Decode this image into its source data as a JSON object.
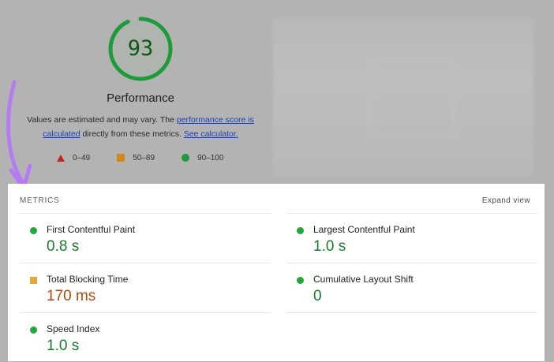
{
  "score": {
    "value": "93",
    "fraction": 0.93,
    "title": "Performance"
  },
  "description": {
    "text_before": "Values are estimated and may vary. The ",
    "link_score": "performance score is calculated",
    "text_middle": " directly from these metrics. ",
    "link_calculator": "See calculator."
  },
  "legend": [
    {
      "range": "0–49",
      "shape": "triangle",
      "color": "#c0231b"
    },
    {
      "range": "50–89",
      "shape": "square",
      "color": "#d4861f"
    },
    {
      "range": "90–100",
      "shape": "circle",
      "color": "#1f9a3a"
    }
  ],
  "metrics_panel": {
    "header": "METRICS",
    "expand_label": "Expand view",
    "items": [
      {
        "name": "First Contentful Paint",
        "value": "0.8 s",
        "status": "good"
      },
      {
        "name": "Largest Contentful Paint",
        "value": "1.0 s",
        "status": "good"
      },
      {
        "name": "Total Blocking Time",
        "value": "170 ms",
        "status": "average"
      },
      {
        "name": "Cumulative Layout Shift",
        "value": "0",
        "status": "good"
      },
      {
        "name": "Speed Index",
        "value": "1.0 s",
        "status": "good"
      }
    ]
  },
  "colors": {
    "good": "#1fa83c",
    "average": "#e4a73a",
    "arrow": "#b57cf2"
  }
}
